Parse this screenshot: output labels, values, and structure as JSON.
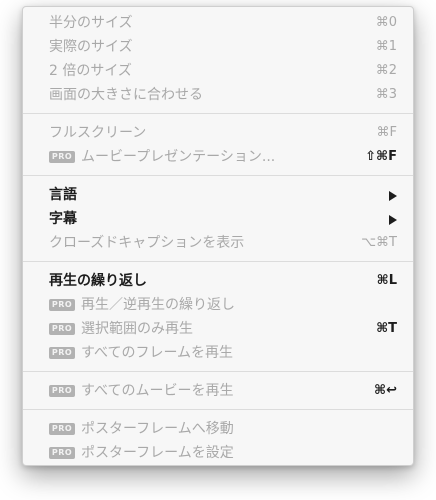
{
  "menu": {
    "groups": [
      [
        {
          "label": "半分のサイズ",
          "shortcut": "⌘0"
        },
        {
          "label": "実際のサイズ",
          "shortcut": "⌘1"
        },
        {
          "label": "2 倍のサイズ",
          "shortcut": "⌘2"
        },
        {
          "label": "画面の大きさに合わせる",
          "shortcut": "⌘3"
        }
      ],
      [
        {
          "label": "フルスクリーン",
          "shortcut": "⌘F"
        },
        {
          "pro": "PRO",
          "label": "ムービープレゼンテーション...",
          "shortcut": "⇧⌘F"
        }
      ],
      [
        {
          "label": "言語",
          "submenu": true
        },
        {
          "label": "字幕",
          "submenu": true
        },
        {
          "label": "クローズドキャプションを表示",
          "shortcut": "⌥⌘T"
        }
      ],
      [
        {
          "label": "再生の繰り返し",
          "shortcut": "⌘L"
        },
        {
          "pro": "PRO",
          "label": "再生／逆再生の繰り返し"
        },
        {
          "pro": "PRO",
          "label": "選択範囲のみ再生",
          "shortcut": "⌘T"
        },
        {
          "pro": "PRO",
          "label": "すべてのフレームを再生"
        }
      ],
      [
        {
          "pro": "PRO",
          "label": "すべてのムービーを再生",
          "shortcut": "⌘↩"
        }
      ],
      [
        {
          "pro": "PRO",
          "label": "ポスターフレームへ移動"
        },
        {
          "pro": "PRO",
          "label": "ポスターフレームを設定"
        }
      ]
    ]
  }
}
